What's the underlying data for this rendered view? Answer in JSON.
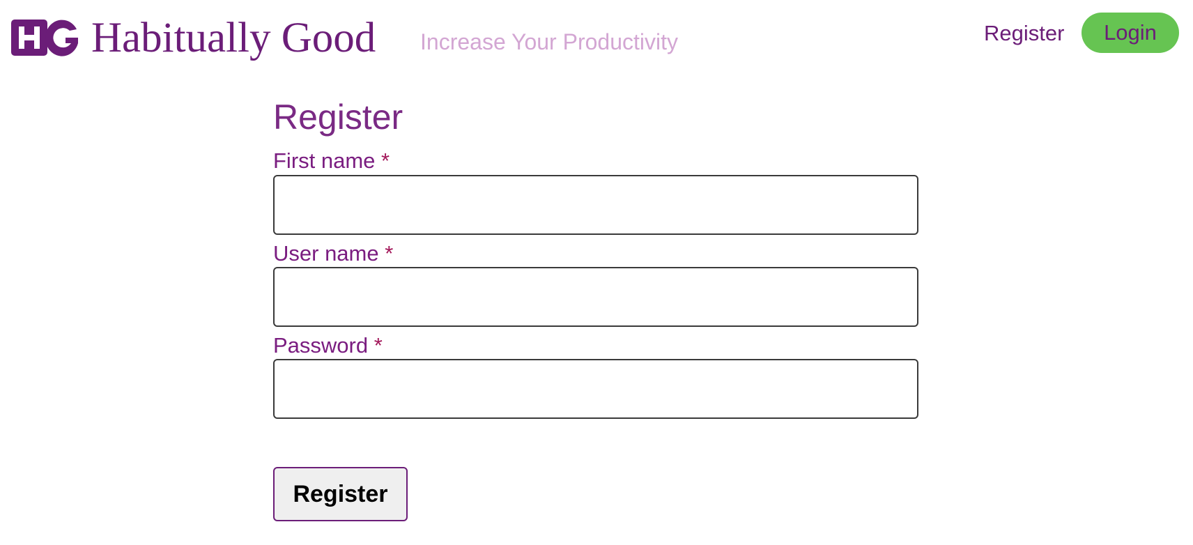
{
  "header": {
    "logo_text": "HG",
    "brand_name": "Habitually Good",
    "tagline": "Increase Your Productivity",
    "nav": {
      "register_label": "Register",
      "login_label": "Login"
    }
  },
  "colors": {
    "brand_purple": "#6b1d78",
    "tagline_lilac": "#d3a6d3",
    "login_green": "#66c452",
    "required_marker": "#a3195b"
  },
  "form": {
    "title": "Register",
    "fields": [
      {
        "label": "First name",
        "required_marker": "*",
        "value": "",
        "placeholder": ""
      },
      {
        "label": "User name",
        "required_marker": "*",
        "value": "",
        "placeholder": ""
      },
      {
        "label": "Password",
        "required_marker": "*",
        "value": "",
        "placeholder": ""
      }
    ],
    "submit_label": "Register"
  }
}
